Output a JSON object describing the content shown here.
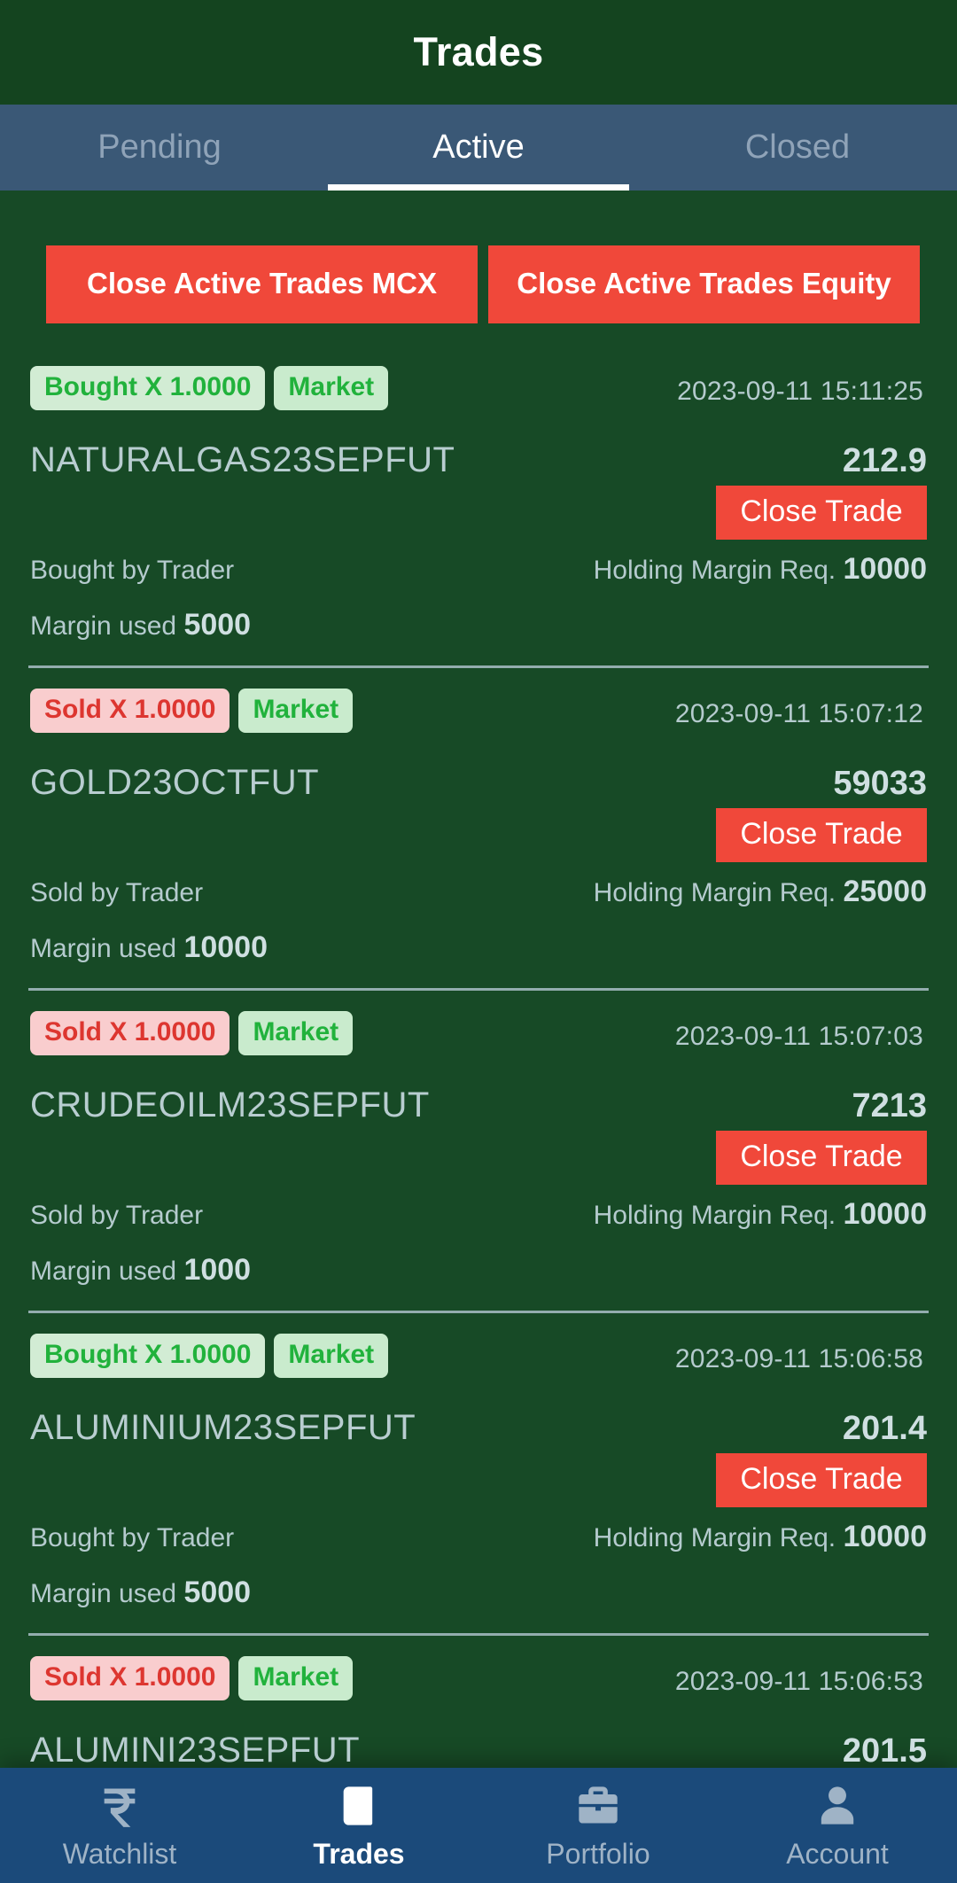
{
  "header": {
    "title": "Trades"
  },
  "tabs": [
    {
      "label": "Pending",
      "active": false
    },
    {
      "label": "Active",
      "active": true
    },
    {
      "label": "Closed",
      "active": false
    }
  ],
  "close_all_buttons": [
    {
      "label": "Close Active Trades MCX"
    },
    {
      "label": "Close Active Trades Equity"
    }
  ],
  "labels": {
    "close_trade": "Close Trade",
    "holding_margin": "Holding Margin Req.",
    "margin_used": "Margin used"
  },
  "colors": {
    "header_bg": "#14441f",
    "page_bg": "#174a26",
    "tabbar_bg": "#3a5876",
    "accent_red": "#f0483a",
    "bottom_nav_bg": "#1b4a7a",
    "buy_badge_bg": "#d2ecd4",
    "buy_badge_text": "#21b23c",
    "sell_badge_bg": "#f9cdce",
    "sell_badge_text": "#dd3630",
    "symbol_text": "#b8cdd0",
    "muted_text": "#b5cbce"
  },
  "trades": [
    {
      "side_badge": "Bought X 1.0000",
      "side": "buy",
      "order_type": "Market",
      "timestamp": "2023-09-11 15:11:25",
      "symbol": "NATURALGAS23SEPFUT",
      "price": "212.9",
      "side_label": "Bought by Trader",
      "holding_margin_value": "10000",
      "margin_used_value": "5000",
      "clipped": false
    },
    {
      "side_badge": "Sold X 1.0000",
      "side": "sell",
      "order_type": "Market",
      "timestamp": "2023-09-11 15:07:12",
      "symbol": "GOLD23OCTFUT",
      "price": "59033",
      "side_label": "Sold by Trader",
      "holding_margin_value": "25000",
      "margin_used_value": "10000",
      "clipped": false
    },
    {
      "side_badge": "Sold X 1.0000",
      "side": "sell",
      "order_type": "Market",
      "timestamp": "2023-09-11 15:07:03",
      "symbol": "CRUDEOILM23SEPFUT",
      "price": "7213",
      "side_label": "Sold by Trader",
      "holding_margin_value": "10000",
      "margin_used_value": "1000",
      "clipped": false
    },
    {
      "side_badge": "Bought X 1.0000",
      "side": "buy",
      "order_type": "Market",
      "timestamp": "2023-09-11 15:06:58",
      "symbol": "ALUMINIUM23SEPFUT",
      "price": "201.4",
      "side_label": "Bought by Trader",
      "holding_margin_value": "10000",
      "margin_used_value": "5000",
      "clipped": false
    },
    {
      "side_badge": "Sold X 1.0000",
      "side": "sell",
      "order_type": "Market",
      "timestamp": "2023-09-11 15:06:53",
      "symbol": "ALUMINI23SEPFUT",
      "price": "201.5",
      "side_label": "",
      "holding_margin_value": "",
      "margin_used_value": "",
      "clipped": true
    }
  ],
  "bottom_nav": [
    {
      "label": "Watchlist",
      "icon": "rupee-icon",
      "active": false
    },
    {
      "label": "Trades",
      "icon": "journal-icon",
      "active": true
    },
    {
      "label": "Portfolio",
      "icon": "briefcase-icon",
      "active": false
    },
    {
      "label": "Account",
      "icon": "person-icon",
      "active": false
    }
  ]
}
